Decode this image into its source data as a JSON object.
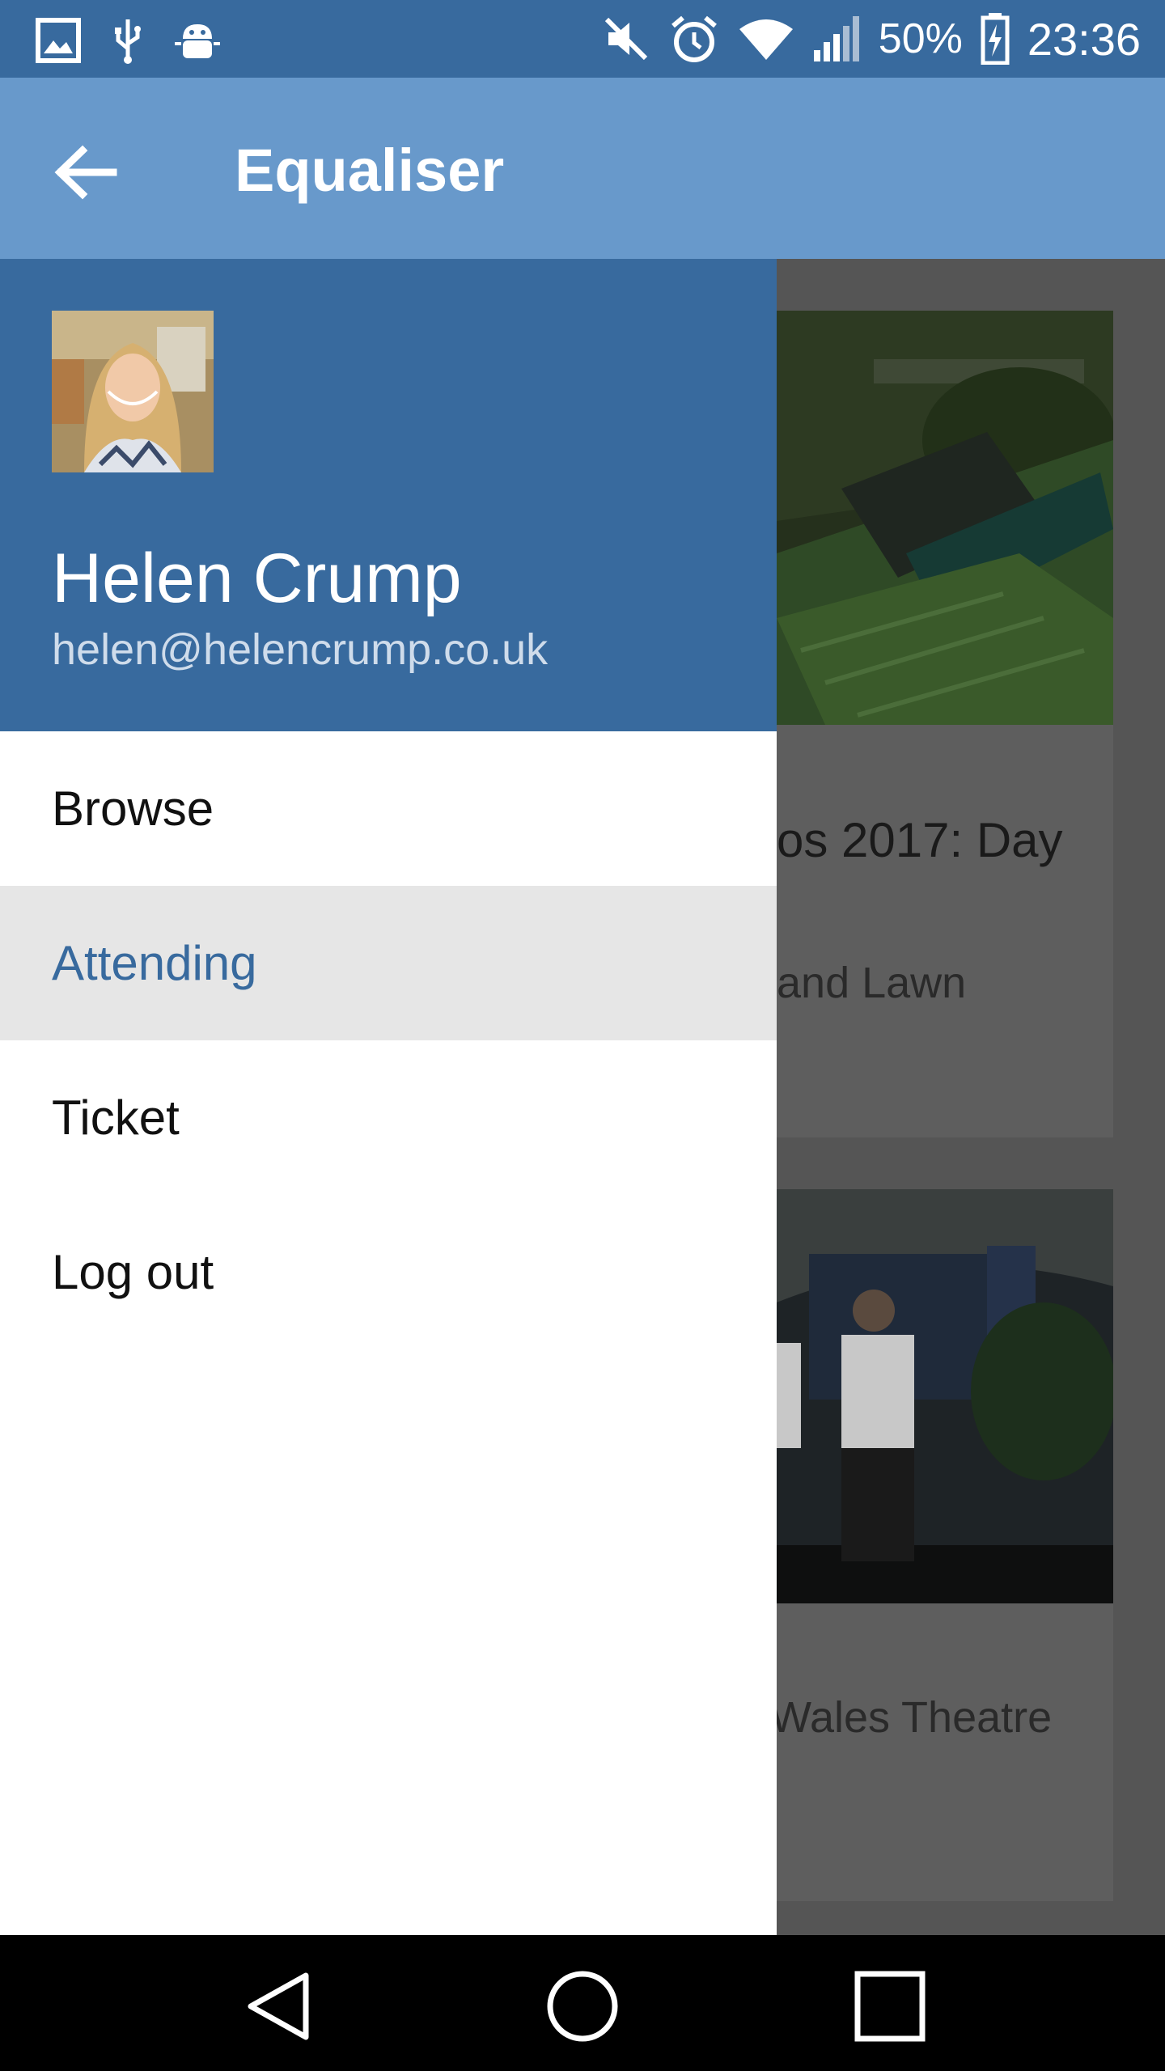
{
  "status_bar": {
    "battery": "50%",
    "time": "23:36",
    "icons": [
      "gallery-icon",
      "usb-icon",
      "android-debug-icon",
      "mute-icon",
      "alarm-icon",
      "wifi-icon",
      "signal-icon",
      "battery-charging-icon"
    ]
  },
  "app_bar": {
    "title": "Equaliser",
    "back_icon": "arrow-left-icon"
  },
  "drawer": {
    "user_name": "Helen Crump",
    "user_email": "helen@helencrump.co.uk",
    "items": [
      {
        "label": "Browse"
      },
      {
        "label": "Attending",
        "active": true
      },
      {
        "label": "Ticket"
      },
      {
        "label": "Log out"
      }
    ]
  },
  "background_cards": [
    {
      "title_fragment": "os 2017: Day",
      "venue_fragment": "and Lawn"
    },
    {
      "venue_fragment": "Wales Theatre"
    }
  ],
  "nav_bar": {
    "icons": [
      "back-triangle-icon",
      "home-circle-icon",
      "recents-square-icon"
    ]
  },
  "colors": {
    "primary_dark": "#386a9e",
    "primary": "#6899cb",
    "active_item_bg": "#e6e6e6"
  }
}
